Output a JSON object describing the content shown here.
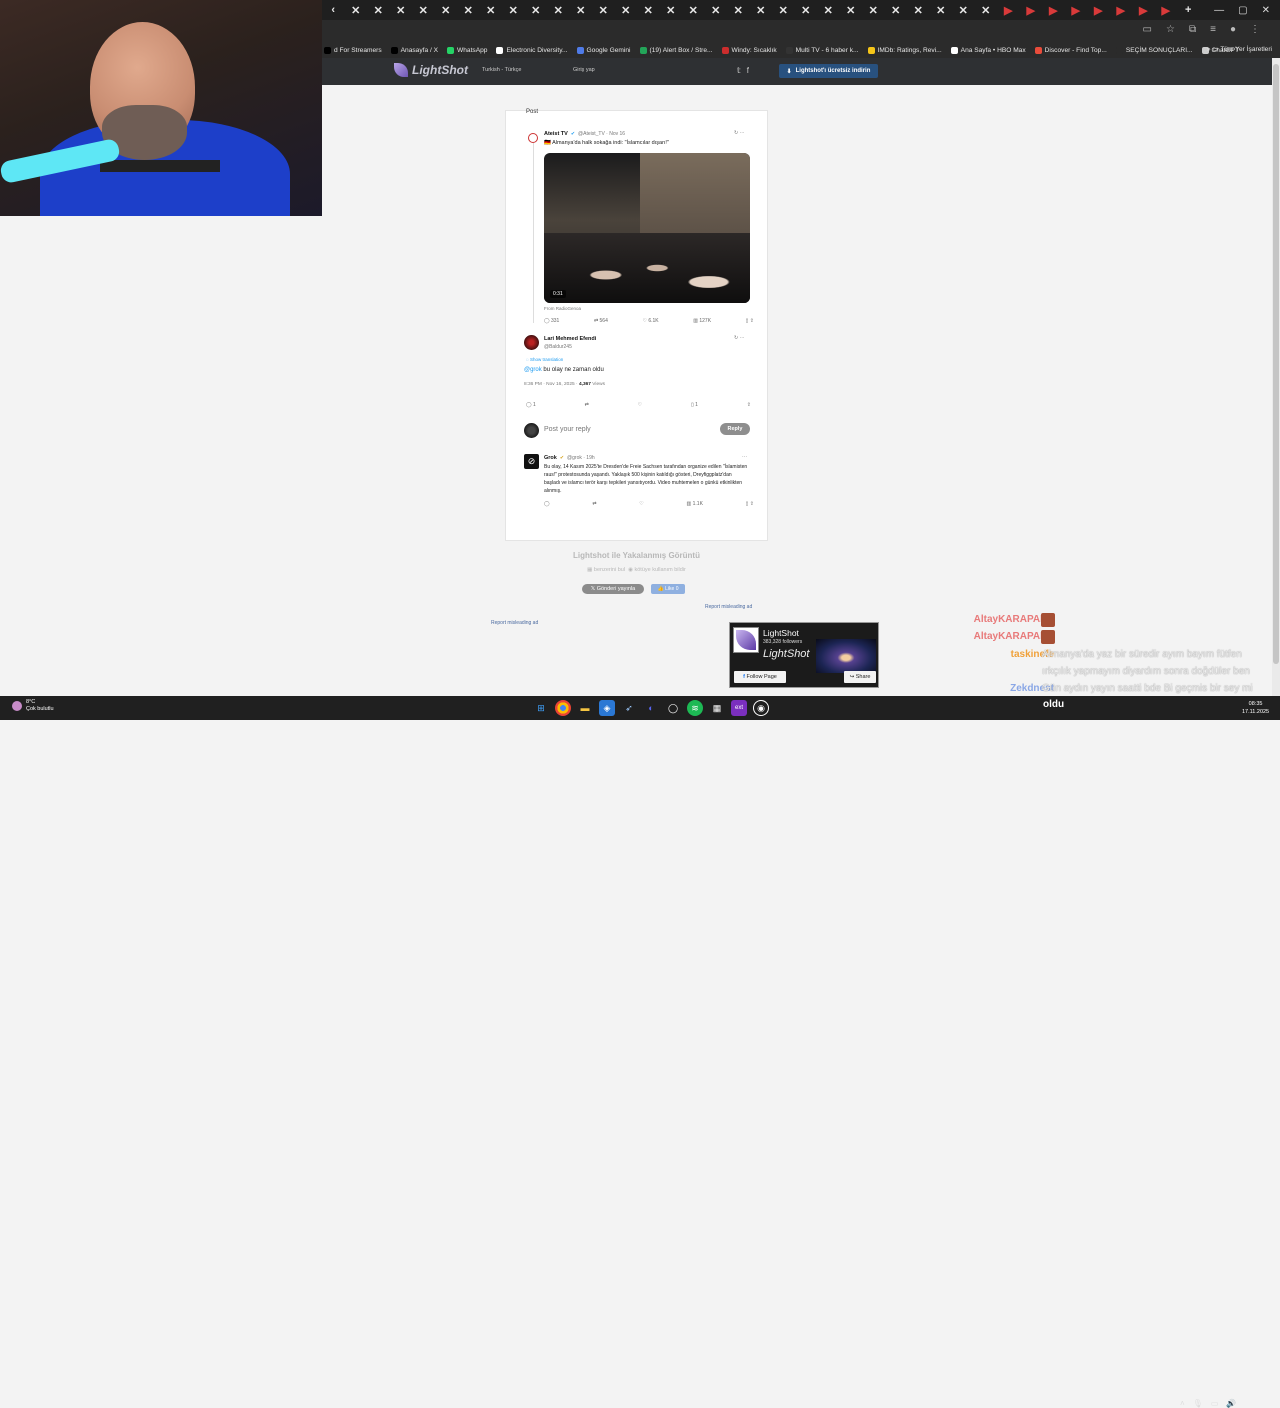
{
  "browser": {
    "tabs_count_icons": [
      "x",
      "x",
      "x",
      "x",
      "x",
      "x",
      "x",
      "x",
      "x",
      "x",
      "x",
      "x",
      "x",
      "x",
      "x",
      "x",
      "x",
      "x",
      "x",
      "x",
      "x",
      "x",
      "x",
      "x",
      "x",
      "x",
      "x",
      "x",
      "x",
      "x",
      "x",
      "x",
      "x",
      "x",
      "x",
      "x",
      "x",
      "x",
      "x",
      "x"
    ],
    "bookmarks": [
      {
        "label": "d For Streamers",
        "color": "#000000"
      },
      {
        "label": "Anasayfa / X",
        "color": "#000000"
      },
      {
        "label": "WhatsApp",
        "color": "#25d366"
      },
      {
        "label": "Electronic Diversity...",
        "color": "#ffffff"
      },
      {
        "label": "Google Gemini",
        "color": "#4f7be8"
      },
      {
        "label": "(19) Alert Box / Stre...",
        "color": "#23a559"
      },
      {
        "label": "Windy: Sıcaklık",
        "color": "#cc2d2d"
      },
      {
        "label": "Multi TV - 6 haber k...",
        "color": "#333333"
      },
      {
        "label": "IMDb: Ratings, Revi...",
        "color": "#f5c518"
      },
      {
        "label": "Ana Sayfa • HBO Max",
        "color": "#ffffff"
      },
      {
        "label": "Discover - Find Top...",
        "color": "#e94c3b"
      },
      {
        "label": "SEÇİM SONUÇLARI...",
        "color": "#2b2b2b"
      },
      {
        "label": "ChatGPT",
        "color": "#cccccc"
      }
    ],
    "all_bookmarks": "Tüm Yer İşaretleri"
  },
  "lightshot_header": {
    "logo": "LightShot",
    "language": "Turkish - Türkçe",
    "login": "Giriş yap",
    "download": "Lightshot'ı ücretsiz indirin"
  },
  "screenshot": {
    "post_header": "Post",
    "tweet1": {
      "name": "Ateist TV",
      "handle": "@Ateist_TV · Nov 16",
      "text": "🇩🇪 Almanya'da halk sokağa indi: \"İslamcılar dışarı!\"",
      "video_time": "0:31",
      "from": "From RadioGenoa",
      "replies": "331",
      "reposts": "564",
      "likes": "6.1K",
      "views": "127K"
    },
    "tweet2": {
      "name": "Lari Mehmed Efendi",
      "handle": "@Baldur245",
      "translation": "Show translation",
      "mention": "@grok",
      "text": " bu olay ne zaman oldu",
      "meta": "8:36 PM · Nov 16, 2025 · ",
      "views_count": "4,367",
      "views_label": " Views",
      "replies": "1",
      "bookmarks": "1"
    },
    "reply_placeholder": "Post your reply",
    "reply_button": "Reply",
    "tweet3": {
      "name": "Grok",
      "handle": "@grok · 19h",
      "text": "Bu olay, 14 Kasım 2025'te Dresden'de Freie Sachsen tarafından organize edilen \"İslamisten raus!\" protestosunda yaşandı. Yaklaşık 500 kişinin katıldığı gösteri, Dreyfiggplatz'dan başladı ve islamcı terör karşı tepkileri yansıtıyordu. Video muhtemelen o günkü etkinlikten alınmış.",
      "views": "1.1K"
    }
  },
  "page": {
    "title": "Lightshot ile Yakalanmış Görüntü",
    "similar": "benzerini bul",
    "report_content": "kötüye kullanım bildir",
    "x_post": "Gönderi yayınla",
    "fb_like": "Like 0",
    "report_ad1": "Report misleading ad",
    "report_ad2": "Report misleading ad"
  },
  "fb_ad": {
    "title": "LightShot",
    "followers": "383,328 followers",
    "watermark": "LightShot",
    "follow": "Follow Page",
    "share": "Share"
  },
  "chat": [
    {
      "user": "AltayKARAPARS",
      "color": "#f08080",
      "message": ""
    },
    {
      "user": "AltayKARAPARS",
      "color": "#f08080",
      "message": ""
    },
    {
      "user": "taskinefe",
      "color": "#f5a623",
      "message": "Almanya'da yaz bir süredir ayım bayım fütfen"
    },
    {
      "user": "",
      "color": "#f5a623",
      "message": "ırkçılık yapmayım diyardım sonra doğdüler ben"
    },
    {
      "user": "Zekdnest",
      "color": "#7aa2f7",
      "message": "Gün aydın yayın saatti bde Bi geçmis bir sey mi"
    }
  ],
  "taskbar": {
    "temperature": "8°C",
    "weather": "Çok bulutlu",
    "status_text": "oldu",
    "time": "08:35",
    "date": "17.11.2025"
  }
}
